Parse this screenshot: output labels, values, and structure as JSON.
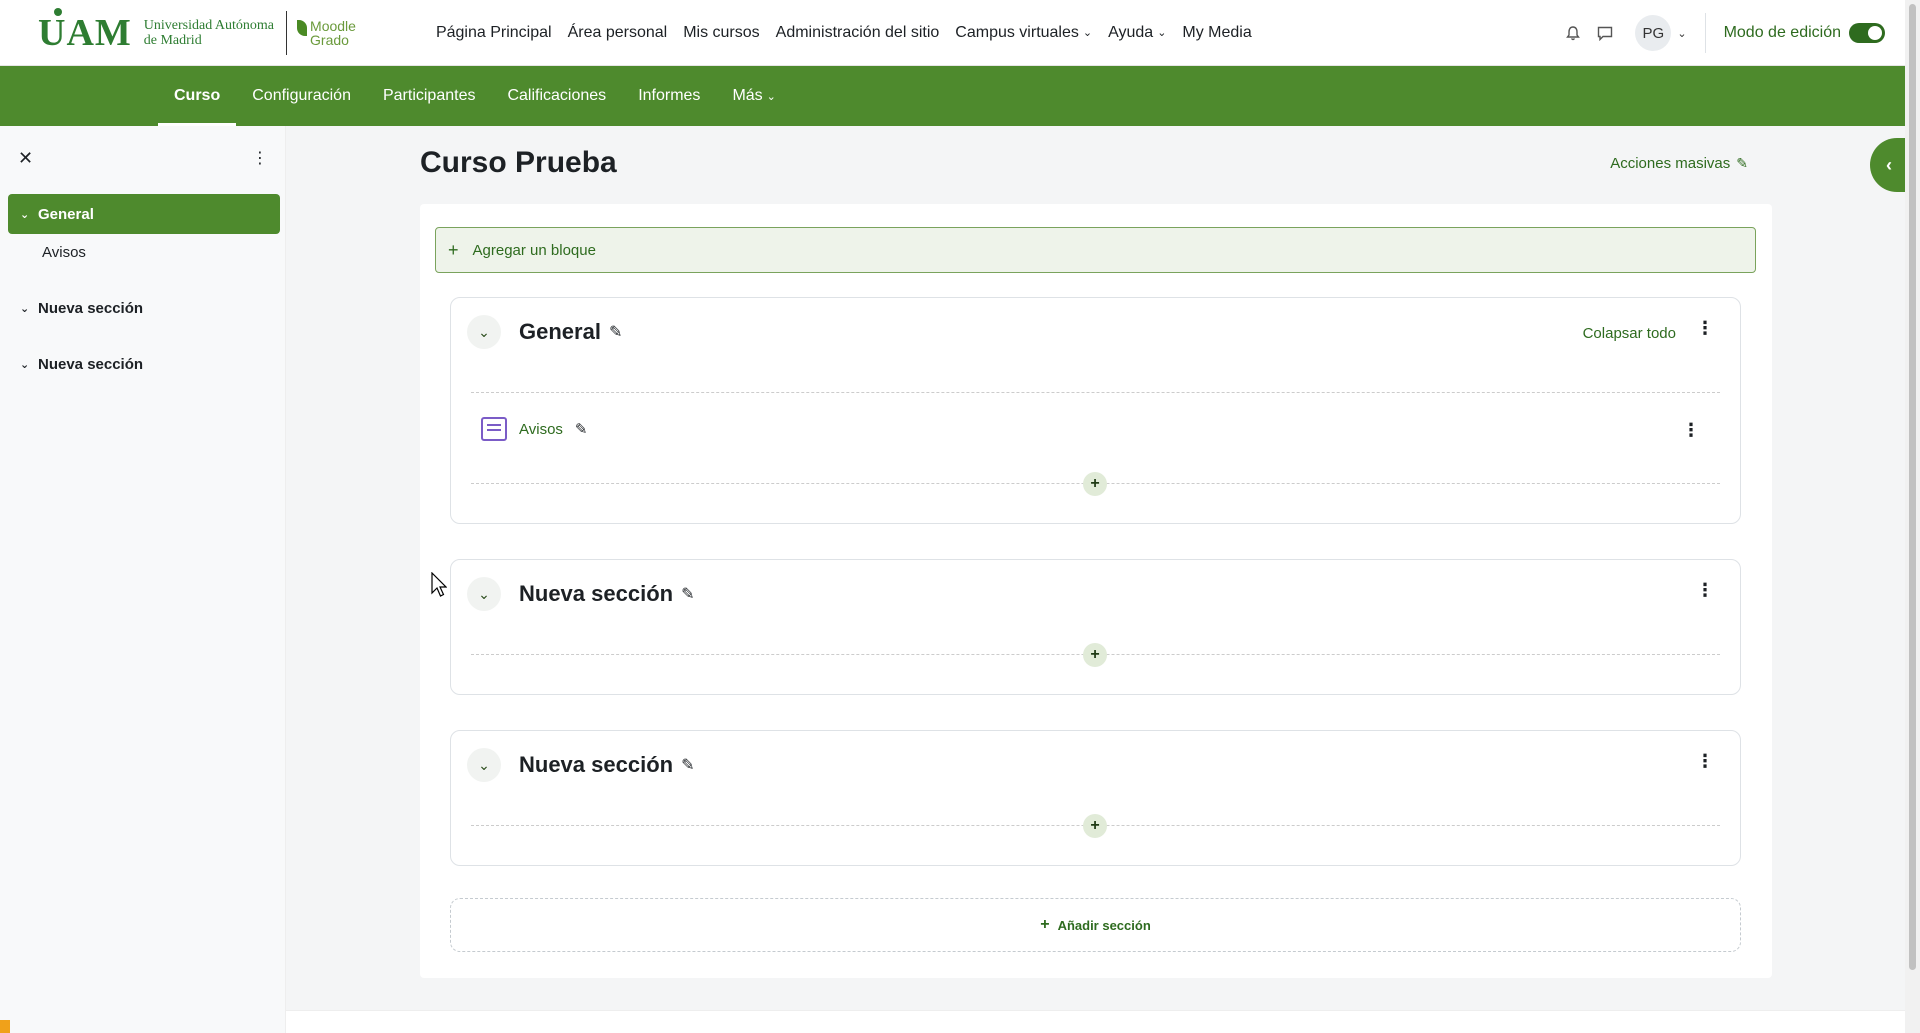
{
  "brand": {
    "uam_mark": "UAM",
    "uam_text_line1": "Universidad Autónoma",
    "uam_text_line2": "de Madrid",
    "moodle_line1": "Moodle",
    "moodle_line2": "Grado"
  },
  "primary_nav": [
    {
      "label": "Página Principal",
      "dropdown": false
    },
    {
      "label": "Área personal",
      "dropdown": false
    },
    {
      "label": "Mis cursos",
      "dropdown": false
    },
    {
      "label": "Administración del sitio",
      "dropdown": false
    },
    {
      "label": "Campus virtuales",
      "dropdown": true
    },
    {
      "label": "Ayuda",
      "dropdown": true
    },
    {
      "label": "My Media",
      "dropdown": false
    }
  ],
  "user": {
    "initials": "PG",
    "edit_mode_label": "Modo de edición",
    "edit_mode_on": true
  },
  "secondary_nav": [
    {
      "label": "Curso",
      "active": true
    },
    {
      "label": "Configuración",
      "active": false
    },
    {
      "label": "Participantes",
      "active": false
    },
    {
      "label": "Calificaciones",
      "active": false
    },
    {
      "label": "Informes",
      "active": false
    },
    {
      "label": "Más",
      "active": false
    }
  ],
  "course_index": {
    "items": [
      {
        "label": "General",
        "active": true
      },
      {
        "label": "Nueva sección",
        "active": false
      },
      {
        "label": "Nueva sección",
        "active": false
      }
    ],
    "sub_items": [
      {
        "label": "Avisos"
      }
    ]
  },
  "main": {
    "course_title": "Curso Prueba",
    "bulk_actions_label": "Acciones masivas",
    "add_block_label": "Agregar un bloque",
    "collapse_all_label": "Colapsar todo",
    "sections": [
      {
        "title": "General",
        "activities": [
          {
            "name": "Avisos",
            "type": "forum"
          }
        ]
      },
      {
        "title": "Nueva sección",
        "activities": []
      },
      {
        "title": "Nueva sección",
        "activities": []
      }
    ],
    "add_section_label": "Añadir sección"
  },
  "colors": {
    "brand_green": "#4e8a2d",
    "link_green": "#2e6b1f",
    "forum_purple": "#7b5cc7"
  }
}
